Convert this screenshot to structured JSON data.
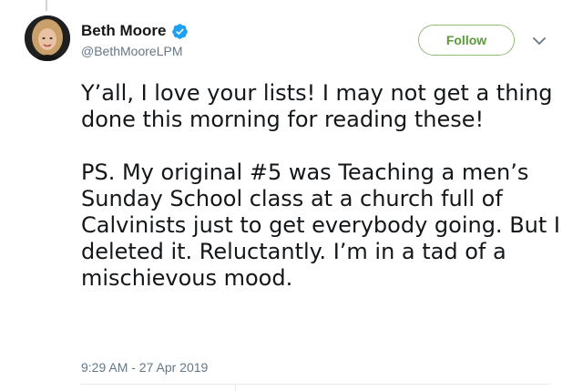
{
  "tweet": {
    "author": {
      "display_name": "Beth Moore",
      "handle": "@BethMooreLPM",
      "verified": true
    },
    "follow_label": "Follow",
    "text_paragraphs": [
      "Y’all, I love your lists! I may not get a thing done this morning for reading these!",
      "PS. My original #5 was Teaching a men’s Sunday School class at a church full of Calvinists just to get everybody going. But I deleted it. Reluctantly. I’m in a tad of a mischievous mood."
    ],
    "timestamp": "9:29 AM - 27 Apr 2019"
  },
  "icons": {
    "verified": "verified-badge-icon",
    "more": "chevron-down-icon",
    "avatar": "profile-photo"
  },
  "colors": {
    "verified_blue": "#1da1f2",
    "follow_accent": "#5a9a3a",
    "secondary_text": "#657786",
    "primary_text": "#14171a"
  }
}
